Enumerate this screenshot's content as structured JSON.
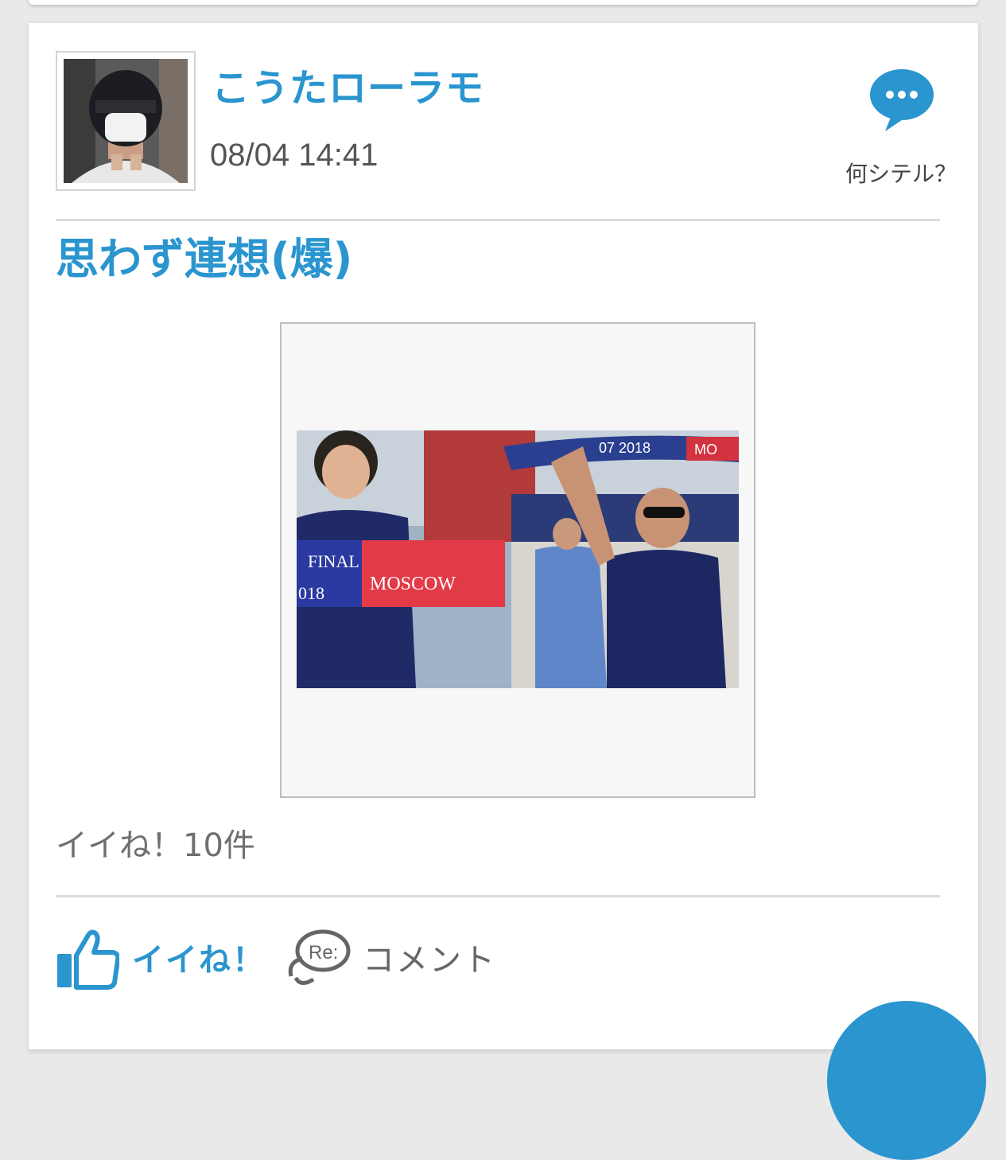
{
  "post": {
    "username": "こうたローラモ",
    "timestamp": "08/04 14:41",
    "status_label": "何シテル？",
    "title": "思わず連想(爆)",
    "likes_count_text": "イイね！10件"
  },
  "photo": {
    "banner_line1": "FINAL",
    "banner_line2": "018",
    "banner_city": "MOSCOW",
    "scarf_text": "07 2018",
    "scarf_text2": "MO"
  },
  "actions": {
    "like_label": "イイね！",
    "comment_label": "コメント",
    "comment_icon_text": "Re:"
  },
  "colors": {
    "accent": "#2a95cf",
    "muted_text": "#6f6f6f"
  },
  "icons": {
    "speech_bubble": "speech-bubble-icon",
    "thumbs_up": "thumbs-up-icon",
    "comment": "re-comment-icon"
  }
}
